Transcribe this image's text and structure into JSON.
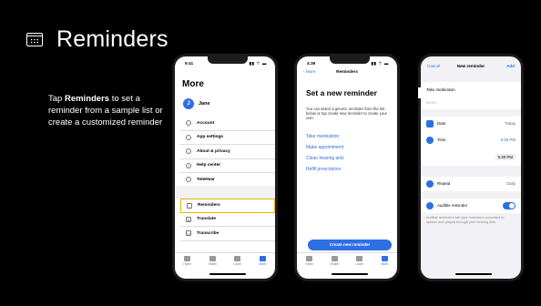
{
  "slide": {
    "title": "Reminders",
    "instruction_bold": "Reminders",
    "instruction_prefix": "Tap ",
    "instruction_rest": " to set a reminder from a sample list or create a customized reminder"
  },
  "phone_more": {
    "status_time": "9:41",
    "status_icons": "▮▮ ⌔ ▬",
    "screen_title": "More",
    "avatar_initial": "J",
    "user_name": "Jane",
    "menu_top": [
      {
        "label": "Account",
        "icon": "user-icon"
      },
      {
        "label": "App settings",
        "icon": "gear-icon"
      },
      {
        "label": "About & privacy",
        "icon": "shield-icon"
      },
      {
        "label": "Help center",
        "icon": "help-icon"
      },
      {
        "label": "TeleHear",
        "icon": "phone-icon"
      }
    ],
    "menu_bottom": [
      {
        "label": "Reminders",
        "icon": "calendar-icon"
      },
      {
        "label": "Translate",
        "icon": "translate-icon"
      },
      {
        "label": "Transcribe",
        "icon": "transcribe-icon"
      }
    ],
    "tabs": [
      "Home",
      "Health",
      "Learn",
      "More"
    ]
  },
  "phone_set": {
    "status_time": "4:39",
    "status_icons": "▮▮ ⌔ ▬",
    "back": "More",
    "nav_title": "Reminders",
    "heading": "Set a new reminder",
    "description": "You can select a generic reminder from the list below or tap create new reminder to create your own.",
    "links": [
      "Take medication",
      "Make appointment",
      "Clean hearing aids",
      "Refill prescription"
    ],
    "cta": "Create new reminder",
    "tabs": [
      "Home",
      "Health",
      "Learn",
      "More"
    ]
  },
  "phone_new": {
    "cancel": "Cancel",
    "nav_title": "New reminder",
    "add": "Add",
    "name_value": "Take medication",
    "notes_placeholder": "Notes",
    "date_label": "Date",
    "date_value": "Today",
    "time_label": "Time",
    "time_value": "5:30 PM",
    "time_pill": "5:30 PM",
    "repeat_label": "Repeat",
    "repeat_value": "Daily",
    "audible_label": "Audible reminder",
    "audible_note": "Audible reminders are your reminders converted to speech and played through your hearing aids."
  }
}
